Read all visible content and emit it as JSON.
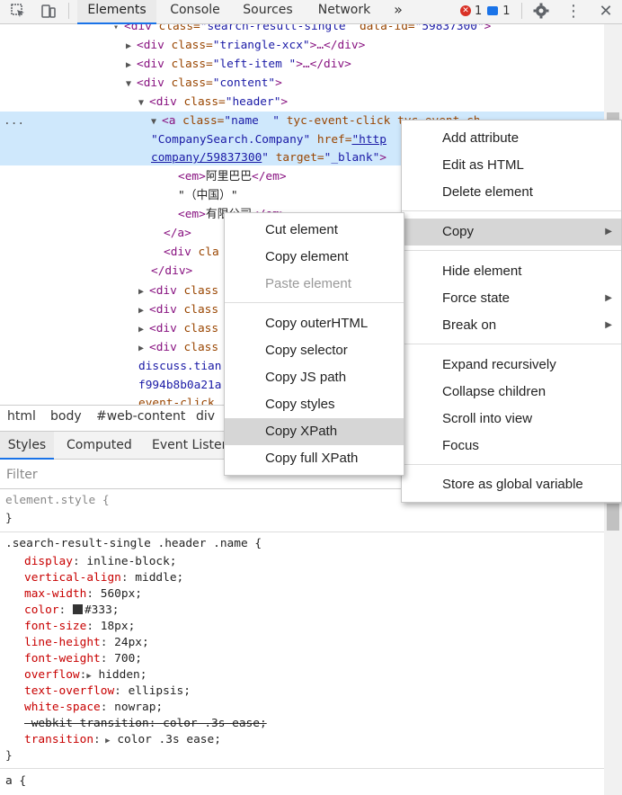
{
  "toolbar": {
    "tabs": [
      "Elements",
      "Console",
      "Sources",
      "Network"
    ],
    "more": "»",
    "error_count": "1",
    "message_count": "1"
  },
  "tree": {
    "line0": {
      "tag_open": "<div ",
      "attr": "class=",
      "val": "\"search-result-single",
      "attr2": "  data-id=",
      "val2": "\"59837300\"",
      "tag_close": ">"
    },
    "line1": {
      "tag": "<div ",
      "attr": "class=",
      "val": "\"triangle-xcx\"",
      "rest": ">…</div>"
    },
    "line2": {
      "tag": "<div ",
      "attr": "class=",
      "val": "\"left-item \"",
      "rest": ">…</div>"
    },
    "line3": {
      "tag": "<div ",
      "attr": "class=",
      "val": "\"content\"",
      "rest": ">"
    },
    "line4": {
      "tag": "<div ",
      "attr": "class=",
      "val": "\"header\"",
      "rest": ">"
    },
    "line5": {
      "tag": "<a ",
      "attr": "class=",
      "val": "\"name  \"",
      "attr2": " tyc-event-click",
      "rest": " tyc-event-ch"
    },
    "line6": {
      "val": "\"CompanySearch.Company\"",
      "attr": " href=",
      "link": "\"http"
    },
    "line7": {
      "link": "company/59837300",
      "val": "\"",
      "attr": " target=",
      "val2": "\"_blank\"",
      "rest": ">"
    },
    "line8": {
      "tag": "<em>",
      "txt": "阿里巴巴",
      "tag2": "</em>"
    },
    "line9": {
      "txt": "\"（中国）\""
    },
    "line10": {
      "tag": "<em>",
      "txt": "有限公司",
      "tag2": "</em>"
    },
    "line11": {
      "tag": "</a>"
    },
    "line12": {
      "tag": "<div ",
      "attr": "cla"
    },
    "line13": {
      "tag": "</div>"
    },
    "line14": {
      "tag": "<div ",
      "attr": "class"
    },
    "line15": {
      "tag": "<div ",
      "attr": "class"
    },
    "line16": {
      "tag": "<div ",
      "attr": "class"
    },
    "line17": {
      "tag": "<div ",
      "attr": "class"
    },
    "line18": {
      "val": "discuss.tian"
    },
    "line19": {
      "val": "f994b8b0a21a"
    },
    "line20": {
      "attr": "event-click"
    },
    "ellipsis": "..."
  },
  "breadcrumb": [
    "html",
    "body",
    "#web-content",
    "div"
  ],
  "subtabs": [
    "Styles",
    "Computed",
    "Event Listen"
  ],
  "filter_placeholder": "Filter",
  "styles": {
    "element_style": "element.style {",
    "close1": "}",
    "selector": ".search-result-single .header .name {",
    "props": [
      {
        "name": "display",
        "value": "inline-block;"
      },
      {
        "name": "vertical-align",
        "value": "middle;"
      },
      {
        "name": "max-width",
        "value": "560px;"
      },
      {
        "name": "color",
        "value": "#333;"
      },
      {
        "name": "font-size",
        "value": "18px;"
      },
      {
        "name": "line-height",
        "value": "24px;"
      },
      {
        "name": "font-weight",
        "value": "700;"
      },
      {
        "name": "overflow",
        "value": "hidden;"
      },
      {
        "name": "text-overflow",
        "value": "ellipsis;"
      },
      {
        "name": "white-space",
        "value": "nowrap;"
      },
      {
        "name": "-webkit-transition",
        "value": "color .3s ease;"
      },
      {
        "name": "transition",
        "value": "color .3s ease;"
      }
    ],
    "close2": "}",
    "next_rule": "a {"
  },
  "menu_main": {
    "items": [
      "Add attribute",
      "Edit as HTML",
      "Delete element",
      "Copy",
      "Hide element",
      "Force state",
      "Break on",
      "Expand recursively",
      "Collapse children",
      "Scroll into view",
      "Focus",
      "Store as global variable"
    ]
  },
  "menu_copy": {
    "items": [
      "Cut element",
      "Copy element",
      "Paste element",
      "Copy outerHTML",
      "Copy selector",
      "Copy JS path",
      "Copy styles",
      "Copy XPath",
      "Copy full XPath"
    ]
  }
}
